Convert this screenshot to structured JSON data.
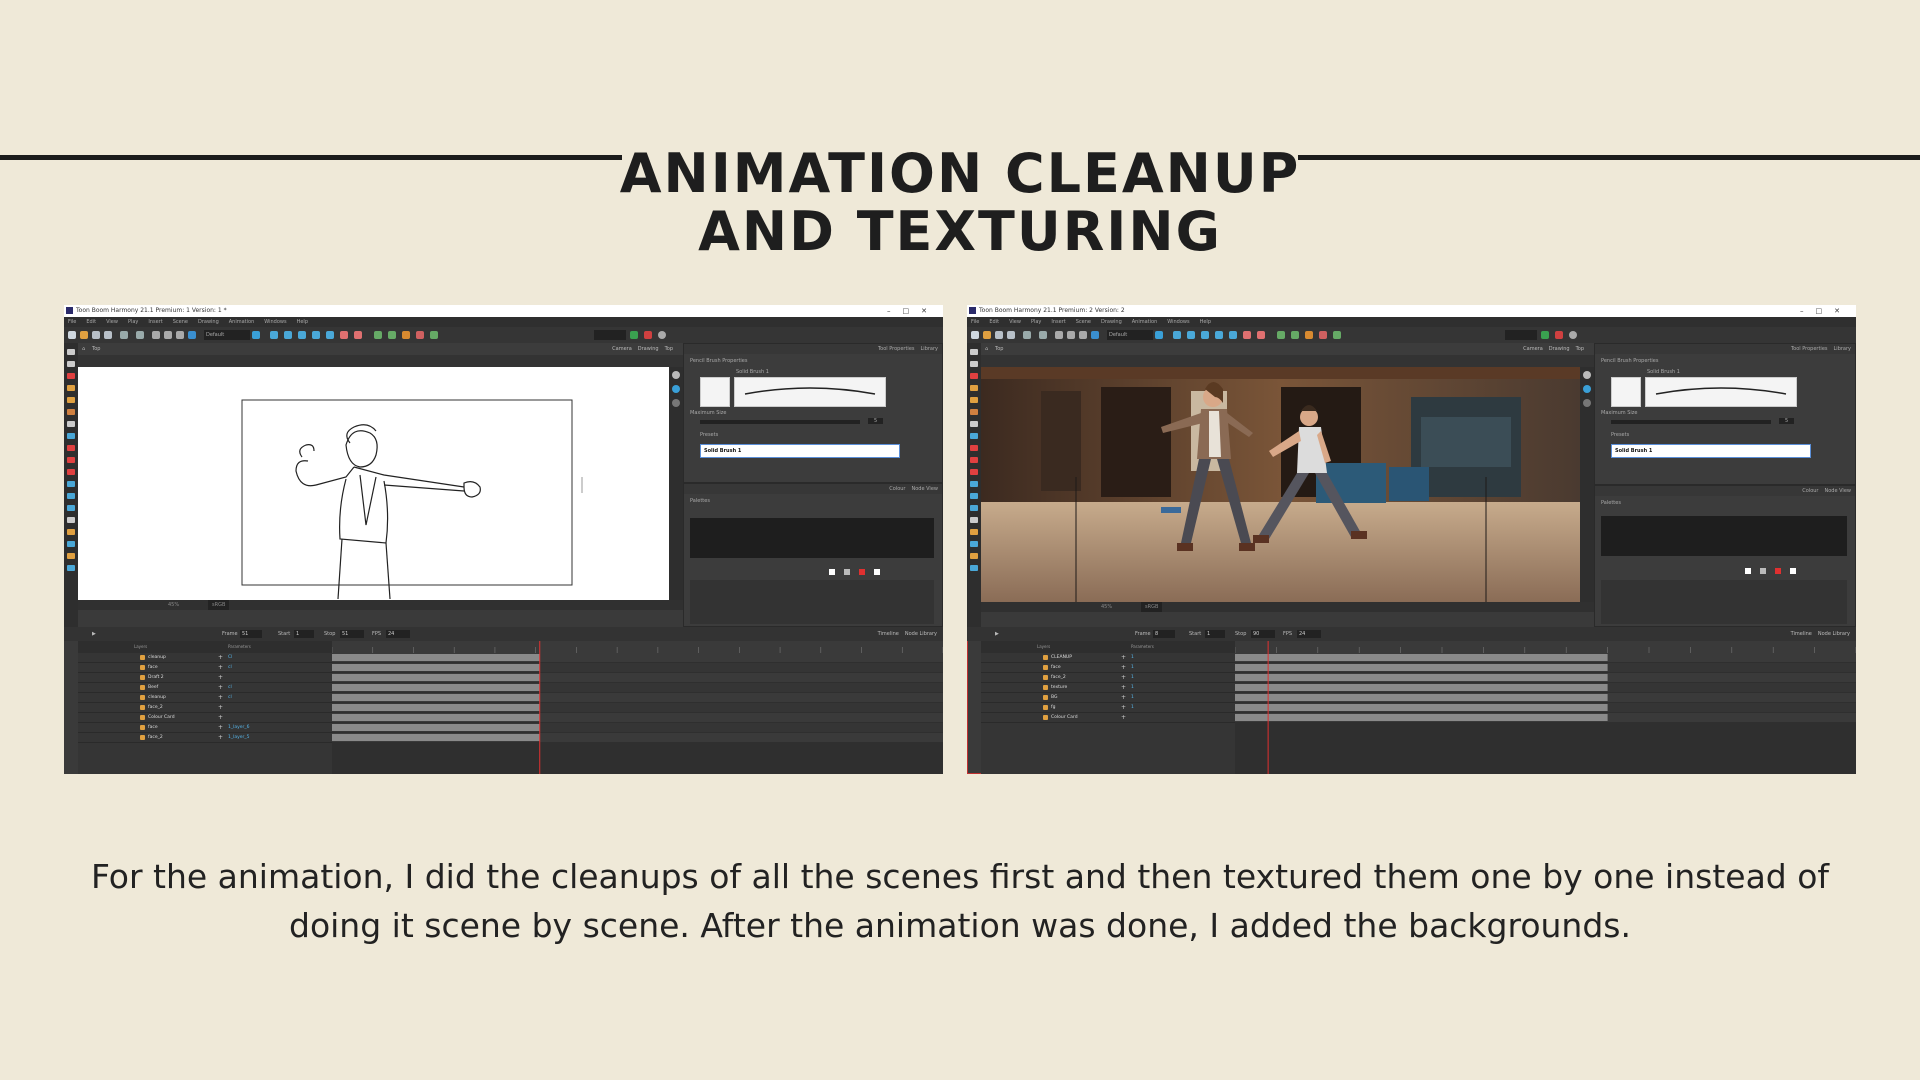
{
  "title": {
    "line1": "ANIMATION CLEANUP",
    "line2": "AND TEXTURING"
  },
  "caption": "For the animation, I did the cleanups of all the scenes first and then textured them one by one instead of doing it scene by scene. After the animation was done, I added the backgrounds.",
  "colors": {
    "background": "#efe9d8",
    "accent_playhead": "#e03030",
    "layer_link": "#55b4e8"
  },
  "screenshot1": {
    "window_title": "Toon Boom Harmony 21.1 Premium: 1 Version: 1 *",
    "window_controls": [
      "–",
      "□",
      "✕"
    ],
    "menu": [
      "File",
      "Edit",
      "View",
      "Play",
      "Insert",
      "Scene",
      "Drawing",
      "Animation",
      "Windows",
      "Help"
    ],
    "toolbar_dropdown": "Default",
    "breadcrumb": "Top",
    "view_tabs": [
      "Camera",
      "Drawing",
      "Top"
    ],
    "viewport_zoom": "45%",
    "viewport_colorspace": "sRGB",
    "tool_properties": {
      "tabs": [
        "Tool Properties",
        "Library"
      ],
      "section": "Pencil Brush Properties",
      "brush_name": "Solid Brush 1",
      "max_size_label": "Maximum Size",
      "max_size_value": "5",
      "presets_label": "Presets",
      "selected_preset": "Solid Brush 1"
    },
    "colour_panel": {
      "tabs": [
        "Colour",
        "Node View"
      ],
      "palettes_label": "Palettes"
    },
    "timeline": {
      "tabs": [
        "Timeline",
        "Node Library"
      ],
      "frame_label": "Frame",
      "frame": "51",
      "start_label": "Start",
      "start": "1",
      "stop_label": "Stop",
      "stop": "51",
      "fps_label": "FPS",
      "fps": "24",
      "layers_header": "Layers",
      "params_header": "Parameters",
      "layers": [
        {
          "name": "cleanup",
          "sub": "Cl"
        },
        {
          "name": "face",
          "sub": "cl"
        },
        {
          "name": "Draft 2",
          "sub": ""
        },
        {
          "name": "Beef",
          "sub": "cl"
        },
        {
          "name": "cleanup",
          "sub": "cl"
        },
        {
          "name": "face_2",
          "sub": ""
        },
        {
          "name": "Colour Card",
          "sub": ""
        },
        {
          "name": "face",
          "sub": "1_layer_6"
        },
        {
          "name": "face_2",
          "sub": "1_layer_5"
        }
      ],
      "playhead_frame": 51,
      "total_frames": 150
    }
  },
  "screenshot2": {
    "window_title": "Toon Boom Harmony 21.1 Premium: 2 Version: 2",
    "window_controls": [
      "–",
      "□",
      "✕"
    ],
    "menu": [
      "File",
      "Edit",
      "View",
      "Play",
      "Insert",
      "Scene",
      "Drawing",
      "Animation",
      "Windows",
      "Help"
    ],
    "toolbar_dropdown": "Default",
    "breadcrumb": "Top",
    "view_tabs": [
      "Camera",
      "Drawing",
      "Top"
    ],
    "viewport_zoom": "45%",
    "viewport_colorspace": "sRGB",
    "tool_properties": {
      "tabs": [
        "Tool Properties",
        "Library"
      ],
      "section": "Pencil Brush Properties",
      "brush_name": "Solid Brush 1",
      "max_size_label": "Maximum Size",
      "max_size_value": "5",
      "presets_label": "Presets",
      "selected_preset": "Solid Brush 1"
    },
    "colour_panel": {
      "tabs": [
        "Colour",
        "Node View"
      ],
      "palettes_label": "Palettes"
    },
    "timeline": {
      "tabs": [
        "Timeline",
        "Node Library"
      ],
      "frame_label": "Frame",
      "frame": "8",
      "start_label": "Start",
      "start": "1",
      "stop_label": "Stop",
      "stop": "90",
      "fps_label": "FPS",
      "fps": "24",
      "layers_header": "Layers",
      "params_header": "Parameters",
      "layers": [
        {
          "name": "CLEANUP",
          "sub": "1"
        },
        {
          "name": "face",
          "sub": "1"
        },
        {
          "name": "face_2",
          "sub": "1"
        },
        {
          "name": "texture",
          "sub": "1"
        },
        {
          "name": "BG",
          "sub": "1"
        },
        {
          "name": "fg",
          "sub": "1"
        },
        {
          "name": "Colour Card",
          "sub": ""
        }
      ],
      "playhead_frame": 8,
      "total_frames": 150
    }
  }
}
